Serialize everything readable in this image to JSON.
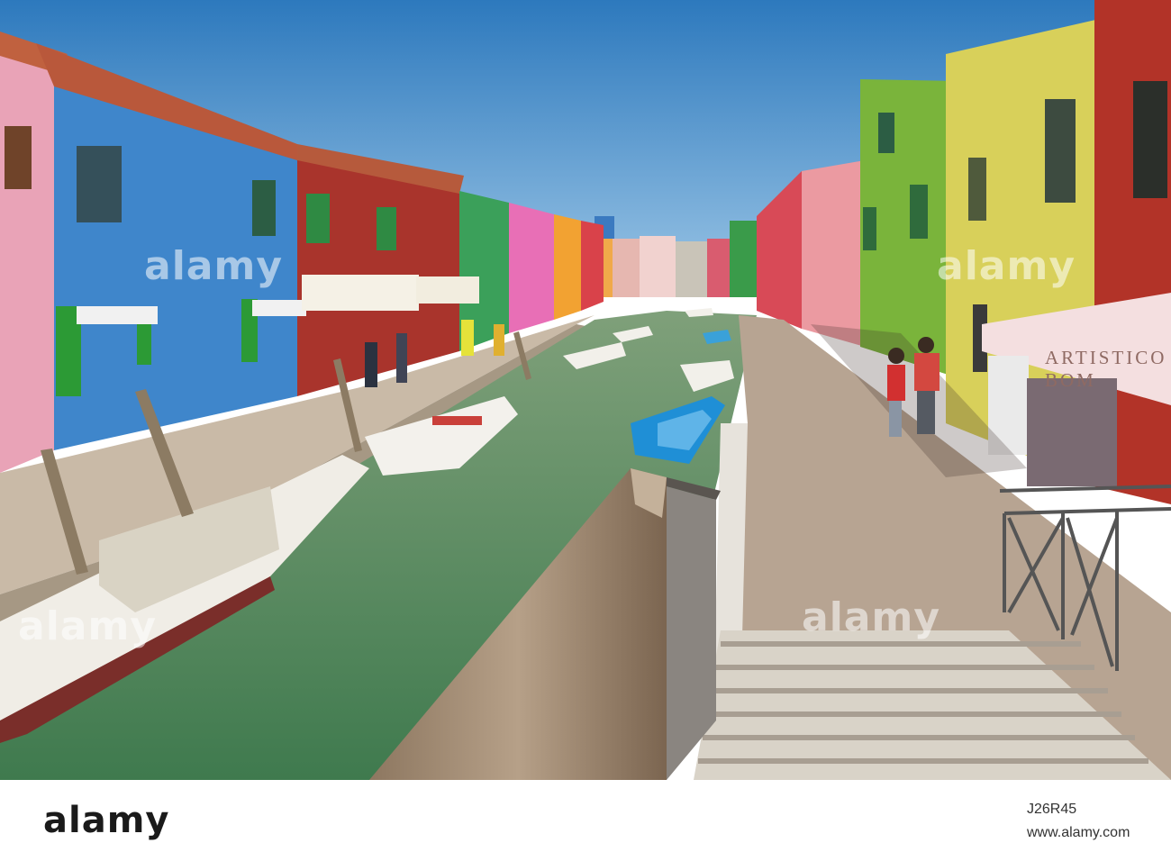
{
  "image": {
    "description_type": "photo",
    "shop_sign_text": "ARTISTICO BOM",
    "watermark_text": "alamy"
  },
  "footer": {
    "logo_text": "alamy",
    "stock_id": "J26R45",
    "site": "www.alamy.com"
  },
  "colors": {
    "sky": "#2f7fc0",
    "water": "#5d8a5a",
    "pavement": "#b6a394",
    "blue_house": "#3e86c9",
    "red_house": "#a8342a",
    "green_house": "#79b03a",
    "yellow_house": "#d8cf55",
    "pink_house": "#e99ea3"
  }
}
